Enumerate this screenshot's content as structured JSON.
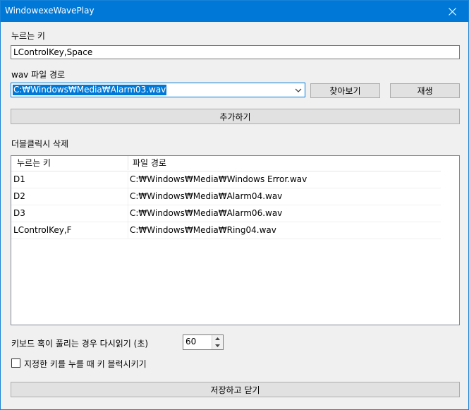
{
  "window": {
    "title": "WindowexeWavePlay"
  },
  "key_label": "누르는 키",
  "key_input_value": "LControlKey,Space",
  "wav_label": "wav 파일 경로",
  "wav_combo_value": "C:₩Windows₩Media₩Alarm03.wav",
  "browse_button": "찾아보기",
  "play_button": "재생",
  "add_button": "추가하기",
  "list_hint": "더블클릭시 삭제",
  "list": {
    "headers": {
      "key": "누르는 키",
      "path": "파일 경로"
    },
    "rows": [
      {
        "key": "D1",
        "path": "C:₩Windows₩Media₩Windows Error.wav"
      },
      {
        "key": "D2",
        "path": "C:₩Windows₩Media₩Alarm04.wav"
      },
      {
        "key": "D3",
        "path": "C:₩Windows₩Media₩Alarm06.wav"
      },
      {
        "key": "LControlKey,F",
        "path": "C:₩Windows₩Media₩Ring04.wav"
      }
    ]
  },
  "reread_label": "키보드 혹이 풀리는 경우 다시읽기 (초)",
  "reread_value": "60",
  "block_checkbox_label": "지정한 키를 누를 때 키 블럭시키기",
  "block_checkbox_checked": false,
  "save_close_button": "저장하고 닫기",
  "colors": {
    "titlebar": "#0078d7",
    "selection": "#0078d7",
    "background": "#f0f0f0"
  }
}
